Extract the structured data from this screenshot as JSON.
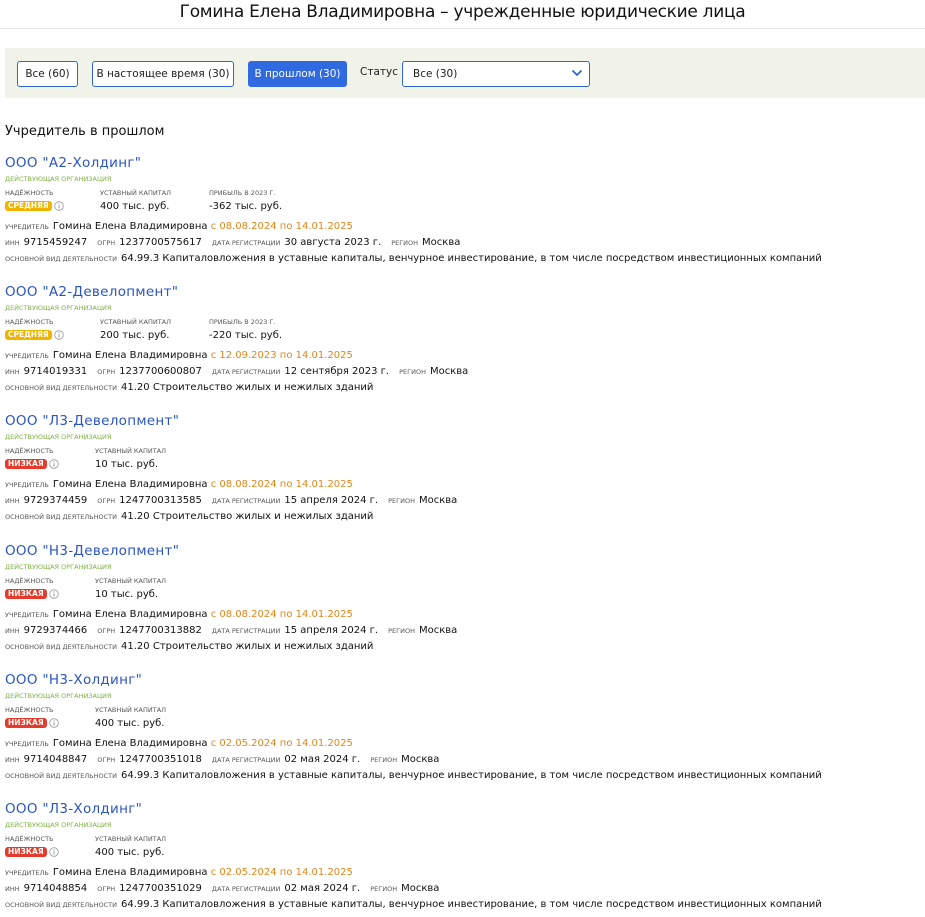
{
  "page": {
    "title": "Гомина Елена Владимировна – учрежденные юридические лица"
  },
  "filters": {
    "all": "Все (60)",
    "current": "В настоящее время (30)",
    "past": "В прошлом (30)",
    "status_label": "Статус",
    "status_value": "Все (30)"
  },
  "section": {
    "title": "Учредитель в прошлом"
  },
  "labels": {
    "reliability": "надёжность",
    "capital": "уставный капитал",
    "profit": "прибыль в 2023 г.",
    "founder": "учредитель",
    "inn": "инн",
    "ogrn": "огрн",
    "reg_date": "дата регистрации",
    "region": "регион",
    "activity": "основной вид деятельности"
  },
  "colors": {
    "accent": "#2f6ae0",
    "link": "#2b55c4",
    "active_status": "#7cb342",
    "period": "#e0861a",
    "badge_mid": "#f0b400",
    "badge_low": "#e43b2c"
  },
  "companies": [
    {
      "name": "ООО \"А2-Холдинг\"",
      "status": "действующая организация",
      "reliability": "средняя",
      "capital": "400 тыс. руб.",
      "profit": "-362 тыс. руб.",
      "founder": "Гомина Елена Владимировна",
      "period": "с 08.08.2024 по 14.01.2025",
      "inn": "9715459247",
      "ogrn": "1237700575617",
      "reg_date": "30 августа 2023 г.",
      "region": "Москва",
      "activity": "64.99.3 Капиталовложения в уставные капиталы, венчурное инвестирование, в том числе посредством инвестиционных компаний"
    },
    {
      "name": "ООО \"А2-Девелопмент\"",
      "status": "действующая организация",
      "reliability": "средняя",
      "capital": "200 тыс. руб.",
      "profit": "-220 тыс. руб.",
      "founder": "Гомина Елена Владимировна",
      "period": "с 12.09.2023 по 14.01.2025",
      "inn": "9714019331",
      "ogrn": "1237700600807",
      "reg_date": "12 сентября 2023 г.",
      "region": "Москва",
      "activity": "41.20 Строительство жилых и нежилых зданий"
    },
    {
      "name": "ООО \"Л3-Девелопмент\"",
      "status": "действующая организация",
      "reliability": "низкая",
      "capital": "10 тыс. руб.",
      "founder": "Гомина Елена Владимировна",
      "period": "с 08.08.2024 по 14.01.2025",
      "inn": "9729374459",
      "ogrn": "1247700313585",
      "reg_date": "15 апреля 2024 г.",
      "region": "Москва",
      "activity": "41.20 Строительство жилых и нежилых зданий"
    },
    {
      "name": "ООО \"Н3-Девелопмент\"",
      "status": "действующая организация",
      "reliability": "низкая",
      "capital": "10 тыс. руб.",
      "founder": "Гомина Елена Владимировна",
      "period": "с 08.08.2024 по 14.01.2025",
      "inn": "9729374466",
      "ogrn": "1247700313882",
      "reg_date": "15 апреля 2024 г.",
      "region": "Москва",
      "activity": "41.20 Строительство жилых и нежилых зданий"
    },
    {
      "name": "ООО \"Н3-Холдинг\"",
      "status": "действующая организация",
      "reliability": "низкая",
      "capital": "400 тыс. руб.",
      "founder": "Гомина Елена Владимировна",
      "period": "с 02.05.2024 по 14.01.2025",
      "inn": "9714048847",
      "ogrn": "1247700351018",
      "reg_date": "02 мая 2024 г.",
      "region": "Москва",
      "activity": "64.99.3 Капиталовложения в уставные капиталы, венчурное инвестирование, в том числе посредством инвестиционных компаний"
    },
    {
      "name": "ООО \"Л3-Холдинг\"",
      "status": "действующая организация",
      "reliability": "низкая",
      "capital": "400 тыс. руб.",
      "founder": "Гомина Елена Владимировна",
      "period": "с 02.05.2024 по 14.01.2025",
      "inn": "9714048854",
      "ogrn": "1247700351029",
      "reg_date": "02 мая 2024 г.",
      "region": "Москва",
      "activity": "64.99.3 Капиталовложения в уставные капиталы, венчурное инвестирование, в том числе посредством инвестиционных компаний"
    }
  ]
}
